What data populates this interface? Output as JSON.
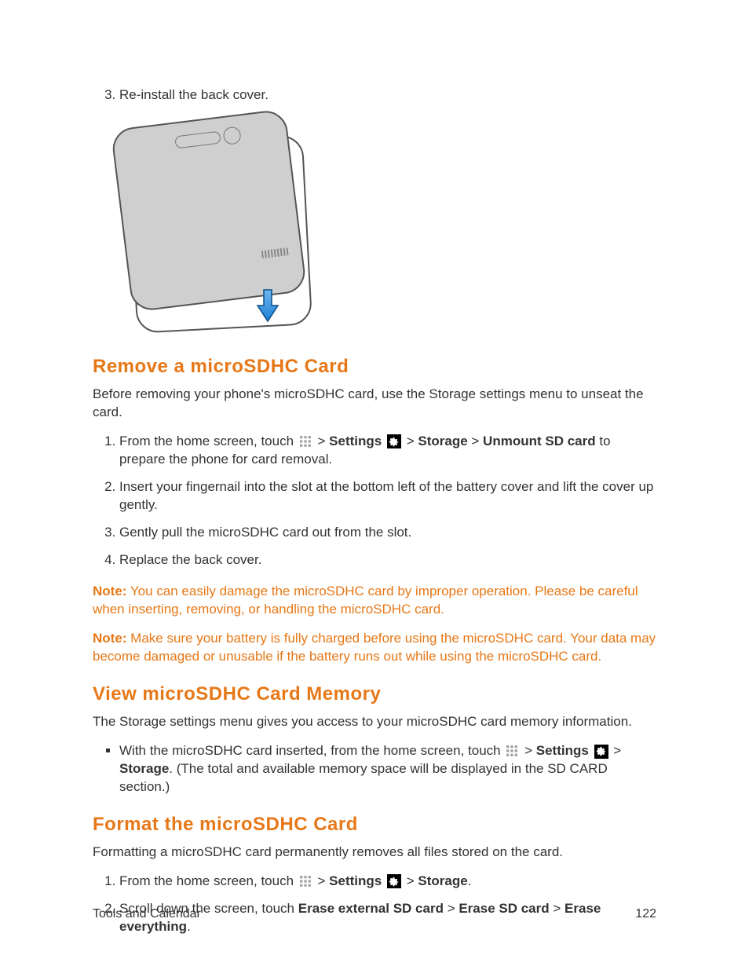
{
  "top_list_start": 3,
  "top_list": [
    "Re-install the back cover."
  ],
  "sec1": {
    "title": "Remove a microSDHC Card",
    "intro": "Before removing your phone's microSDHC card, use the Storage settings menu to unseat the card.",
    "steps": {
      "s1a": "From the home screen, touch ",
      "s1b": " > ",
      "s1c": "Settings",
      "s1d": " > ",
      "s1e": "Storage",
      "s1f": " > ",
      "s1g": "Unmount SD card",
      "s1h": " to prepare the phone for card removal.",
      "s2": "Insert your fingernail into the slot at the bottom left of the battery cover and lift the cover up gently.",
      "s3": "Gently pull the microSDHC card out from the slot.",
      "s4": "Replace the back cover."
    },
    "note1_label": "Note:",
    "note1_text": " You can easily damage the microSDHC card by improper operation. Please be careful when inserting, removing, or handling the microSDHC card.",
    "note2_label": "Note:",
    "note2_text": " Make sure your battery is fully charged before using the microSDHC card. Your data may become damaged or unusable if the battery runs out while using the microSDHC card."
  },
  "sec2": {
    "title": "View microSDHC Card Memory",
    "intro": "The Storage settings menu gives you access to your microSDHC card memory information.",
    "b1a": "With the microSDHC card inserted, from the home screen, touch ",
    "b1b": " > ",
    "b1c": "Settings",
    "b1d": " > ",
    "b1e": "Storage",
    "b1f": ". (The total and available memory space will be displayed in the SD CARD section.)"
  },
  "sec3": {
    "title": "Format the microSDHC Card",
    "intro": "Formatting a microSDHC card permanently removes all files stored on the card.",
    "s1a": "From the home screen, touch ",
    "s1b": " > ",
    "s1c": "Settings",
    "s1d": " > ",
    "s1e": "Storage",
    "s1f": ".",
    "s2a": "Scroll down the screen, touch ",
    "s2b": "Erase external SD card",
    "s2c": " > ",
    "s2d": "Erase SD card",
    "s2e": " > ",
    "s2f": "Erase everything",
    "s2g": "."
  },
  "footer": {
    "section": "Tools and Calendar",
    "page": "122"
  }
}
